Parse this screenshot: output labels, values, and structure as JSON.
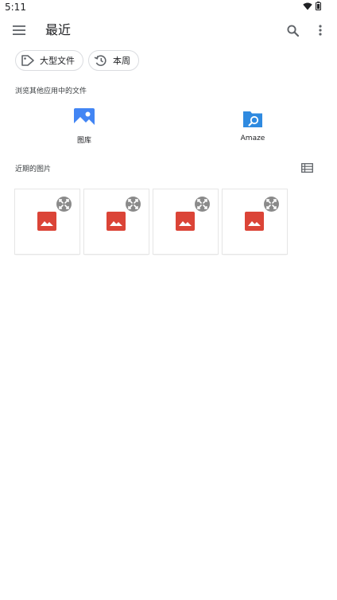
{
  "status_bar": {
    "time": "5:11"
  },
  "toolbar": {
    "title": "最近"
  },
  "chips": [
    {
      "label": "大型文件",
      "icon": "label-tag-icon"
    },
    {
      "label": "本周",
      "icon": "history-icon"
    }
  ],
  "browse_section": {
    "label": "浏览其他应用中的文件",
    "apps": [
      {
        "name": "图库",
        "icon": "gallery-app-icon"
      },
      {
        "name": "Amaze",
        "icon": "amaze-app-icon"
      }
    ]
  },
  "recent_section": {
    "label": "近期的图片",
    "thumbnails": [
      {
        "icon": "image-file-icon"
      },
      {
        "icon": "image-file-icon"
      },
      {
        "icon": "image-file-icon"
      },
      {
        "icon": "image-file-icon"
      }
    ]
  },
  "colors": {
    "image_red": "#db4437",
    "expand_gray": "#8a8a8a",
    "gallery_blue": "#4285f4",
    "amaze_blue": "#2f8ae0",
    "icon_gray": "#5f6368"
  }
}
